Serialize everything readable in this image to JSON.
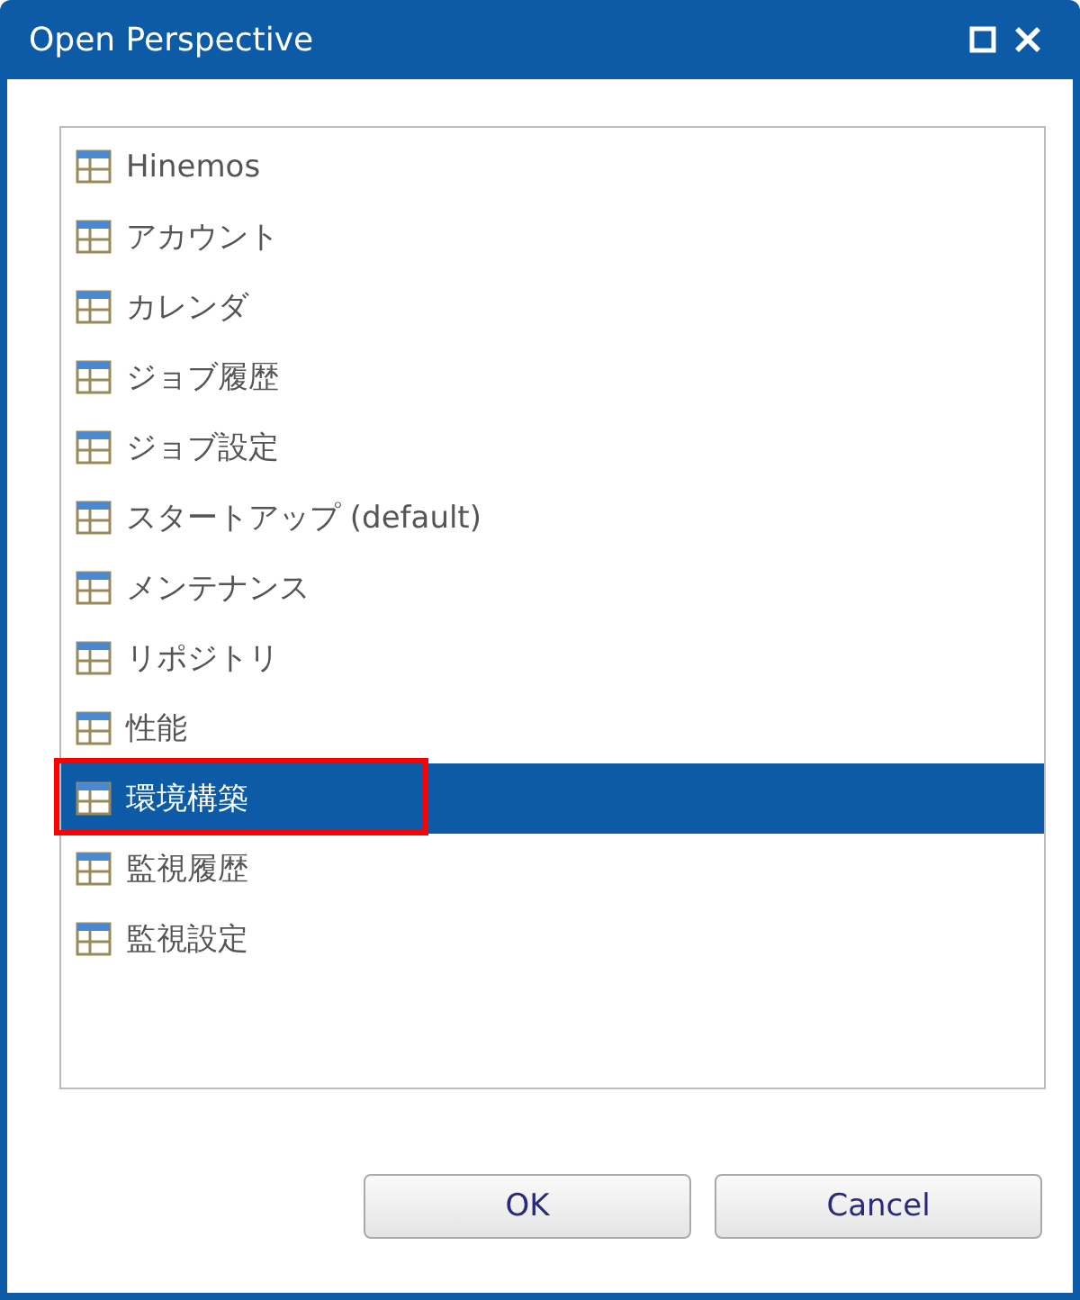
{
  "window": {
    "title": "Open Perspective"
  },
  "perspectives": [
    {
      "label": "Hinemos",
      "selected": false,
      "annotated": false
    },
    {
      "label": "アカウント",
      "selected": false,
      "annotated": false
    },
    {
      "label": "カレンダ",
      "selected": false,
      "annotated": false
    },
    {
      "label": "ジョブ履歴",
      "selected": false,
      "annotated": false
    },
    {
      "label": "ジョブ設定",
      "selected": false,
      "annotated": false
    },
    {
      "label": "スタートアップ (default)",
      "selected": false,
      "annotated": false
    },
    {
      "label": "メンテナンス",
      "selected": false,
      "annotated": false
    },
    {
      "label": "リポジトリ",
      "selected": false,
      "annotated": false
    },
    {
      "label": "性能",
      "selected": false,
      "annotated": false
    },
    {
      "label": "環境構築",
      "selected": true,
      "annotated": true
    },
    {
      "label": "監視履歴",
      "selected": false,
      "annotated": false
    },
    {
      "label": "監視設定",
      "selected": false,
      "annotated": false
    }
  ],
  "buttons": [
    "OK",
    "Cancel"
  ]
}
